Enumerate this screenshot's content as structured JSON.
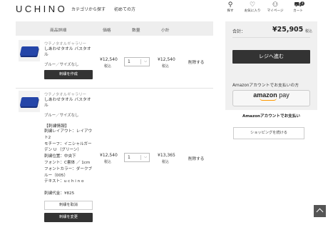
{
  "header": {
    "logo": "UCHINO",
    "nav": [
      "カテゴリから探す",
      "初めての方"
    ],
    "icons": [
      {
        "name": "search",
        "label": "探す",
        "glyph": "⚲"
      },
      {
        "name": "heart",
        "label": "お気に入り",
        "glyph": "♡"
      },
      {
        "name": "user",
        "label": "マイページ",
        "glyph": "⚇"
      },
      {
        "name": "cart",
        "label": "カート",
        "glyph": "⛟",
        "badge": "3"
      }
    ]
  },
  "table": {
    "headers": {
      "product": "商品詳細",
      "price": "価格",
      "qty": "数量",
      "subtotal": "小計"
    }
  },
  "items": [
    {
      "brand": "ウチノタオルギャラリー",
      "name": "しあわせタオル バスタオル",
      "variant": "ブルー／サイズなし",
      "price": "¥12,540",
      "tax": "税込",
      "qty": "1",
      "subtotal": "¥12,540",
      "subtax": "税込",
      "delete": "削除する",
      "engrave_button": "刺繍を作成"
    },
    {
      "brand": "ウチノタオルギャラリー",
      "name": "しあわせタオル バスタオル",
      "variant": "ブルー／サイズなし",
      "engrave_head": "【刺繍情報】",
      "engrave_lines": [
        "刺繍レイアウト：レイアウ",
        "ト2",
        "モチーフ：イニシャルガー",
        "デン U （グリーン）",
        "刺繍位置：中央下",
        "フォント：C書体 ／ 1cm",
        "フォントカラー：ダークブ",
        "ルー（005）",
        "テキスト：u c h i n o"
      ],
      "engrave_fee": "刺繍代金：¥825",
      "cancel_button": "刺繍を取消",
      "change_button": "刺繍を変更",
      "price": "¥12,540",
      "tax": "税込",
      "qty": "1",
      "subtotal": "¥13,365",
      "subtax": "税込",
      "delete": "削除する"
    }
  ],
  "summary": {
    "total_label": "合計：",
    "total": "¥25,905",
    "tax": "税込",
    "checkout": "レジへ進む",
    "amazon_text": "Amazonアカウントでお支払いの方",
    "amazon_logo": "amazon",
    "amazon_pay": "pay",
    "amazon_sub": "Amazonアカウントでお支払い",
    "continue": "ショッピングを続ける"
  },
  "colors": {
    "dark": "#333333",
    "amazon_orange": "#ff9900",
    "towel_blue": "#2445a8"
  }
}
